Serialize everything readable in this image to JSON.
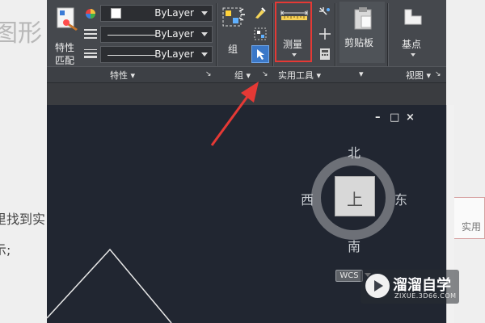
{
  "background_page": {
    "title_fragment": "图形",
    "line1_fragment": "里找到实",
    "line2_fragment": "示;",
    "right_fragment": "实用"
  },
  "ribbon": {
    "properties": {
      "match_label_1": "特性",
      "match_label_2": "匹配",
      "color_combo": "ByLayer",
      "linetype_combo": "ByLayer",
      "lineweight_combo": "ByLayer",
      "panel_label": "特性"
    },
    "groups": {
      "group_label": "组",
      "panel_label": "组"
    },
    "utilities": {
      "measure_label": "测量",
      "panel_label": "实用工具"
    },
    "clipboard": {
      "label": "剪贴板"
    },
    "view": {
      "base_label": "基点",
      "panel_label": "视图"
    }
  },
  "viewport": {
    "controls": [
      "–",
      "□",
      "×"
    ]
  },
  "viewcube": {
    "north": "北",
    "south": "南",
    "east": "东",
    "west": "西",
    "face": "上",
    "wcs_label": "WCS"
  },
  "watermark": {
    "title": "溜溜自学",
    "url": "ZIXUE.3D66.COM"
  },
  "colors": {
    "ribbon_bg": "#45484d",
    "viewport_bg": "#212631",
    "highlight": "#e53935",
    "arrow": "#e53935"
  }
}
